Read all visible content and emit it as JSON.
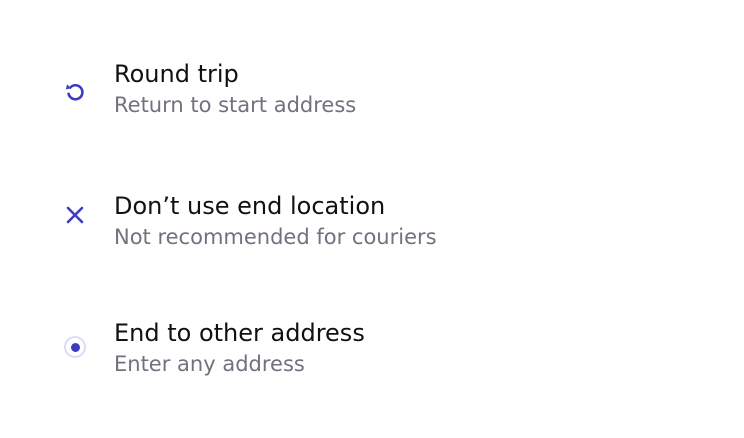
{
  "accent_color": "#3b3cc4",
  "options": [
    {
      "id": "round-trip",
      "icon": "refresh-icon",
      "title": "Round trip",
      "subtitle": "Return to start address"
    },
    {
      "id": "no-end-location",
      "icon": "close-icon",
      "title": "Don’t use end location",
      "subtitle": "Not recommended for couriers"
    },
    {
      "id": "other-address",
      "icon": "radio-selected-icon",
      "title": "End to other address",
      "subtitle": "Enter any address"
    }
  ]
}
